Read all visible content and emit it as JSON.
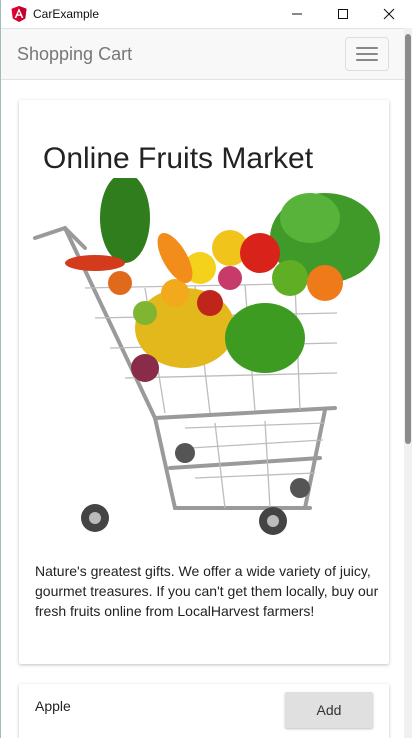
{
  "window": {
    "title": "CarExample",
    "controls": {
      "minimize": "—",
      "maximize": "☐",
      "close": "✕"
    }
  },
  "navbar": {
    "brand": "Shopping Cart"
  },
  "hero_card": {
    "title": "Online Fruits Market",
    "image_alt": "Shopping cart full of fruits and vegetables",
    "description": "Nature's greatest gifts. We offer a wide variety of juicy, gourmet treasures. If you can't get them locally, buy our fresh fruits online from LocalHarvest farmers!"
  },
  "products": [
    {
      "name": "Apple",
      "button_label": "Add"
    }
  ],
  "colors": {
    "angular_red": "#dd0031",
    "navbar_bg": "#f8f8f8",
    "button_bg": "#e0e0e0"
  }
}
